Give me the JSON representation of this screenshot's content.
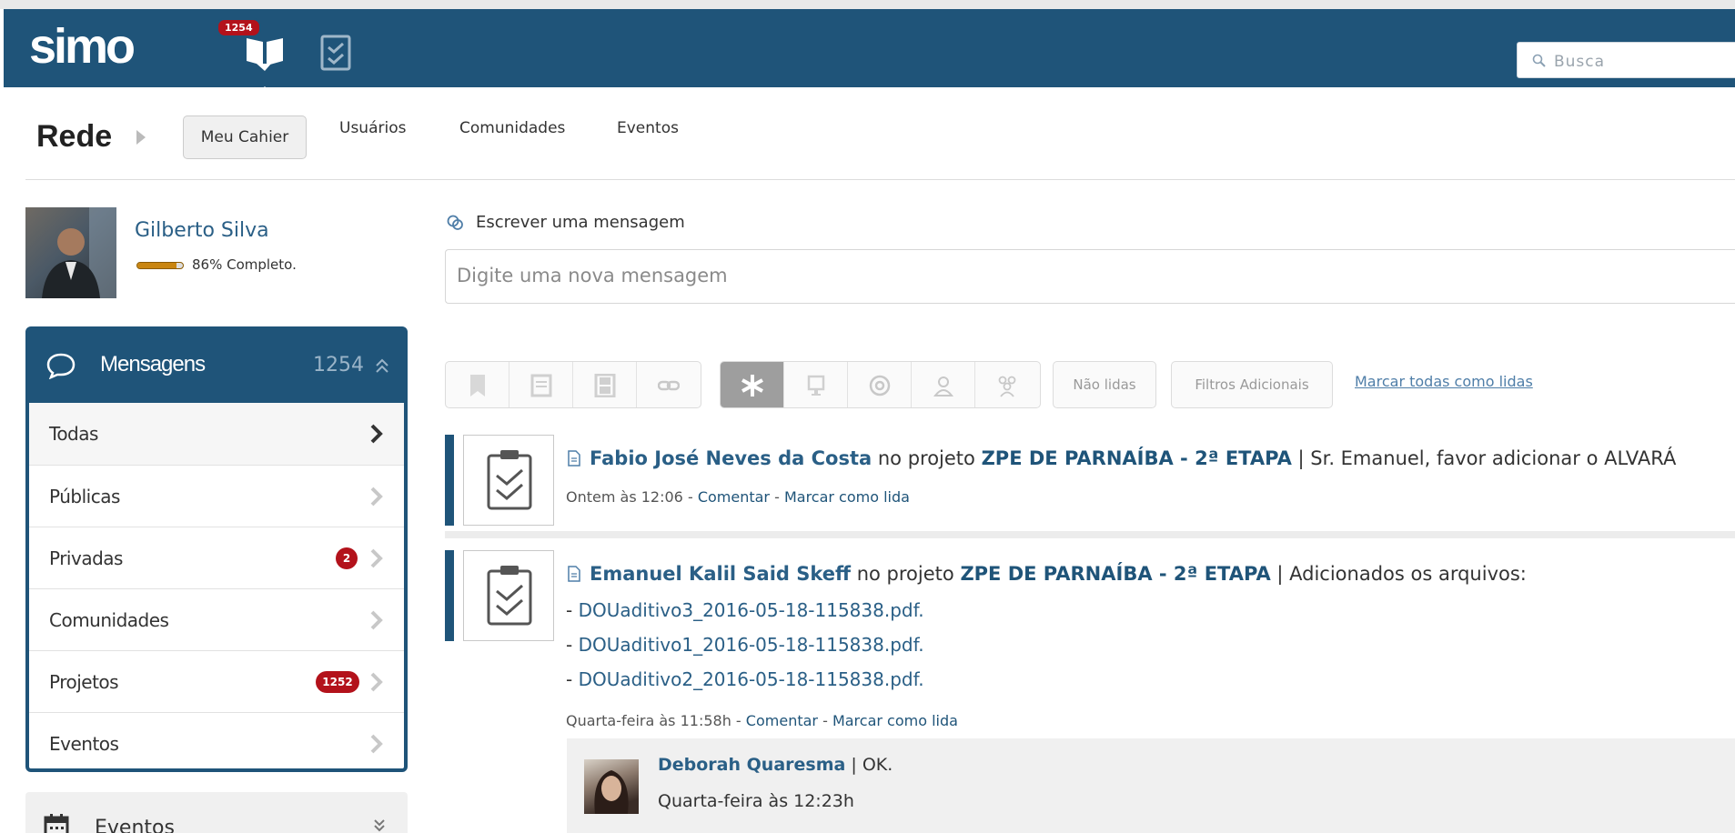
{
  "app": {
    "logo": "simo",
    "messages_badge": "1254",
    "search_placeholder": "Busca",
    "icons": {
      "messages": "book-chat-icon",
      "tasks": "task-checklist-icon",
      "search": "search-icon"
    }
  },
  "breadcrumb": {
    "title": "Rede",
    "tabs": [
      {
        "label": "Meu Cahier",
        "active": true
      },
      {
        "label": "Usuários"
      },
      {
        "label": "Comunidades"
      },
      {
        "label": "Eventos"
      }
    ]
  },
  "profile": {
    "name": "Gilberto Silva",
    "completion_percent": 86,
    "completion_text": "86% Completo."
  },
  "messages_panel": {
    "title": "Mensagens",
    "count": "1254",
    "items": [
      {
        "label": "Todas",
        "badge": ""
      },
      {
        "label": "Públicas",
        "badge": ""
      },
      {
        "label": "Privadas",
        "badge": "2"
      },
      {
        "label": "Comunidades",
        "badge": ""
      },
      {
        "label": "Projetos",
        "badge": "1252"
      },
      {
        "label": "Eventos",
        "badge": ""
      }
    ]
  },
  "events_panel": {
    "title": "Eventos"
  },
  "composer": {
    "label": "Escrever uma mensagem",
    "placeholder": "Digite uma nova mensagem"
  },
  "filters": {
    "group1_icons": [
      "bookmark-icon",
      "document-icon",
      "film-icon",
      "link-icon"
    ],
    "group2_icons": [
      "asterisk-icon",
      "monitor-icon",
      "at-icon",
      "user-icon",
      "users-icon"
    ],
    "unread_label": "Não lidas",
    "additional_label": "Filtros Adicionais",
    "mark_all_label": "Marcar todas como lidas"
  },
  "posts": [
    {
      "author": "Fabio José Neves da Costa",
      "connector": "no projeto",
      "project": "ZPE DE PARNAÍBA - 2ª ETAPA",
      "text": "| Sr. Emanuel, favor adicionar o ALVARÁ",
      "time": "Ontem às 12:06",
      "comment_label": "Comentar",
      "mark_read_label": "Marcar como lida"
    },
    {
      "author": "Emanuel Kalil Said Skeff",
      "connector": "no projeto",
      "project": "ZPE DE PARNAÍBA - 2ª ETAPA",
      "text": "| Adicionados os arquivos:",
      "files": [
        "DOUaditivo3_2016-05-18-115838.pdf.",
        "DOUaditivo1_2016-05-18-115838.pdf.",
        "DOUaditivo2_2016-05-18-115838.pdf."
      ],
      "time": "Quarta-feira às 11:58h",
      "comment_label": "Comentar",
      "mark_read_label": "Marcar como lida",
      "reply": {
        "author": "Deborah Quaresma",
        "text": "| OK.",
        "time": "Quarta-feira às 12:23h"
      }
    }
  ]
}
